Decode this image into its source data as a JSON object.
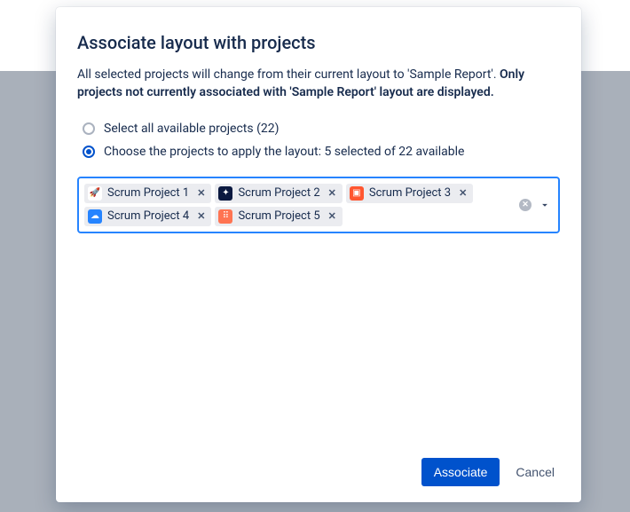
{
  "dialog": {
    "title": "Associate layout with projects",
    "description_plain": "All selected projects will change from their current layout to 'Sample Report'. ",
    "description_bold": "Only projects not currently associated with 'Sample Report' layout are displayed.",
    "radio_select_all": "Select all available projects (22)",
    "radio_choose": "Choose the projects to apply the layout: 5 selected of 22 available",
    "selectedOption": "choose",
    "buttons": {
      "primary": "Associate",
      "cancel": "Cancel"
    }
  },
  "projectSelect": {
    "selected": [
      {
        "name": "Scrum Project 1",
        "iconBg": "#ffffff",
        "iconEmoji": "🚀"
      },
      {
        "name": "Scrum Project 2",
        "iconBg": "#0b1940",
        "iconEmoji": "✦"
      },
      {
        "name": "Scrum Project 3",
        "iconBg": "#ff5630",
        "iconEmoji": "▣"
      },
      {
        "name": "Scrum Project 4",
        "iconBg": "#2684ff",
        "iconEmoji": "☁"
      },
      {
        "name": "Scrum Project 5",
        "iconBg": "#ff7452",
        "iconEmoji": "⠿"
      }
    ]
  }
}
